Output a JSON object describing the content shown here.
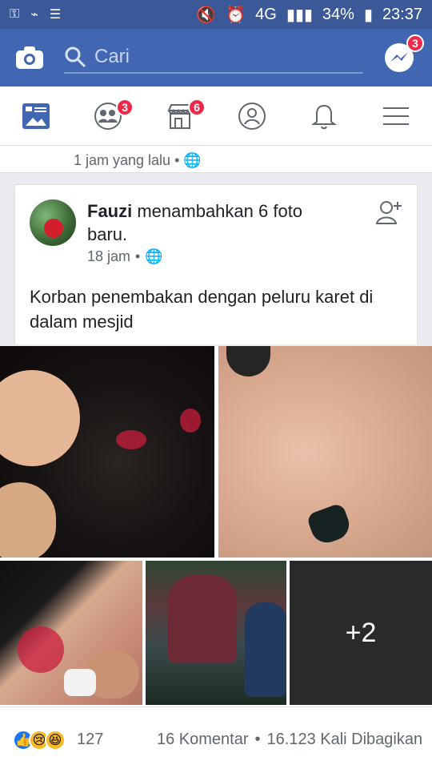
{
  "status_bar": {
    "network": "4G",
    "battery": "34%",
    "time": "23:37"
  },
  "header": {
    "search_placeholder": "Cari",
    "messenger_badge": "3"
  },
  "nav": {
    "friends_badge": "3",
    "marketplace_badge": "6"
  },
  "previous_post": {
    "time": "1 jam yang lalu",
    "separator": "•"
  },
  "post": {
    "author": "Fauzi",
    "action": " menambahkan 6 foto baru.",
    "time": "18 jam",
    "separator": "•",
    "caption": "Korban penembakan dengan peluru karet di dalam mesjid",
    "more_photos": "+2"
  },
  "reactions": {
    "count": "127",
    "comments": "16 Komentar",
    "separator": "•",
    "shares": "16.123 Kali Dibagikan"
  },
  "colors": {
    "facebook_blue": "#4267b2",
    "status_blue": "#3b5998",
    "badge_red": "#f02849"
  }
}
